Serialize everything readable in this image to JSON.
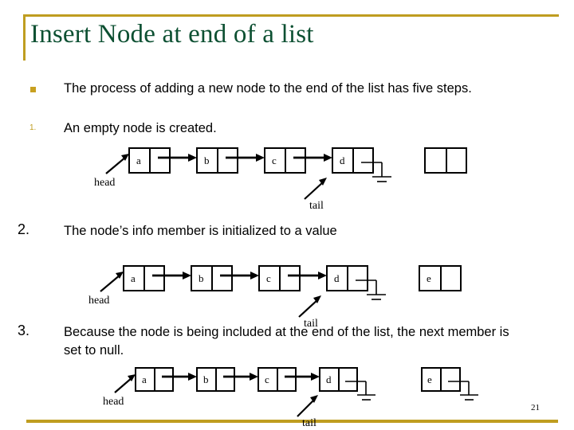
{
  "slide": {
    "title": "Insert Node at end of a list",
    "page_number": "21",
    "accent_color": "#bf9d20",
    "title_color": "#0d5032"
  },
  "bullets": [
    {
      "marker": "",
      "marker_style": "square",
      "text": "The process of adding a new node to the end of the list has five steps."
    },
    {
      "marker": "1.",
      "marker_style": "gold-number",
      "text": "An empty node is created."
    },
    {
      "marker": "2.",
      "marker_style": "black-number",
      "text": "The node’s info member is initialized to a value"
    },
    {
      "marker": "3.",
      "marker_style": "black-number",
      "text": "Because the node is being included at the end of the list, the next member is set to null."
    }
  ],
  "diagrams": [
    {
      "id": "diagram-step-1",
      "nodes": [
        "a",
        "b",
        "c",
        "d"
      ],
      "new_node_label": "",
      "new_node_null": false,
      "pointers": {
        "head": "head",
        "tail": "tail"
      },
      "tail_null": true
    },
    {
      "id": "diagram-step-2",
      "nodes": [
        "a",
        "b",
        "c",
        "d"
      ],
      "new_node_label": "e",
      "new_node_null": false,
      "pointers": {
        "head": "head",
        "tail": "tail"
      },
      "tail_null": true
    },
    {
      "id": "diagram-step-3",
      "nodes": [
        "a",
        "b",
        "c",
        "d"
      ],
      "new_node_label": "e",
      "new_node_null": true,
      "pointers": {
        "head": "head",
        "tail": "tail"
      },
      "tail_null": true
    }
  ]
}
